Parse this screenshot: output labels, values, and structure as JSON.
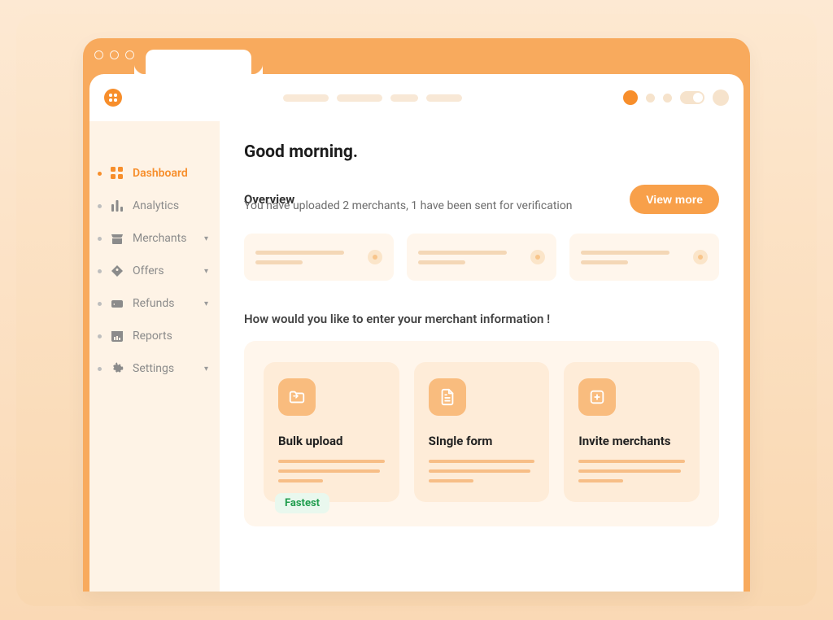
{
  "sidebar": {
    "items": [
      {
        "label": "Dashboard",
        "icon": "grid-icon",
        "active": true,
        "expandable": false
      },
      {
        "label": "Analytics",
        "icon": "bars-icon",
        "active": false,
        "expandable": false
      },
      {
        "label": "Merchants",
        "icon": "store-icon",
        "active": false,
        "expandable": true
      },
      {
        "label": "Offers",
        "icon": "tag-icon",
        "active": false,
        "expandable": true
      },
      {
        "label": "Refunds",
        "icon": "refund-icon",
        "active": false,
        "expandable": true
      },
      {
        "label": "Reports",
        "icon": "calendar-icon",
        "active": false,
        "expandable": false
      },
      {
        "label": "Settings",
        "icon": "gear-icon",
        "active": false,
        "expandable": true
      }
    ]
  },
  "greeting": "Good morning.",
  "overview": {
    "title": "Overview",
    "desc": "You have uploaded 2 merchants, 1 have been sent for verification",
    "view_more_label": "View more"
  },
  "question": "How would you like to enter your merchant information !",
  "options": [
    {
      "title": "Bulk upload",
      "icon": "folder-plus-icon",
      "badge": "Fastest"
    },
    {
      "title": "SIngle form",
      "icon": "document-icon",
      "badge": null
    },
    {
      "title": "Invite merchants",
      "icon": "plus-square-icon",
      "badge": null
    }
  ],
  "colors": {
    "accent": "#F78E2B",
    "surface": "#FFF6EC",
    "card": "#FEECD8"
  }
}
